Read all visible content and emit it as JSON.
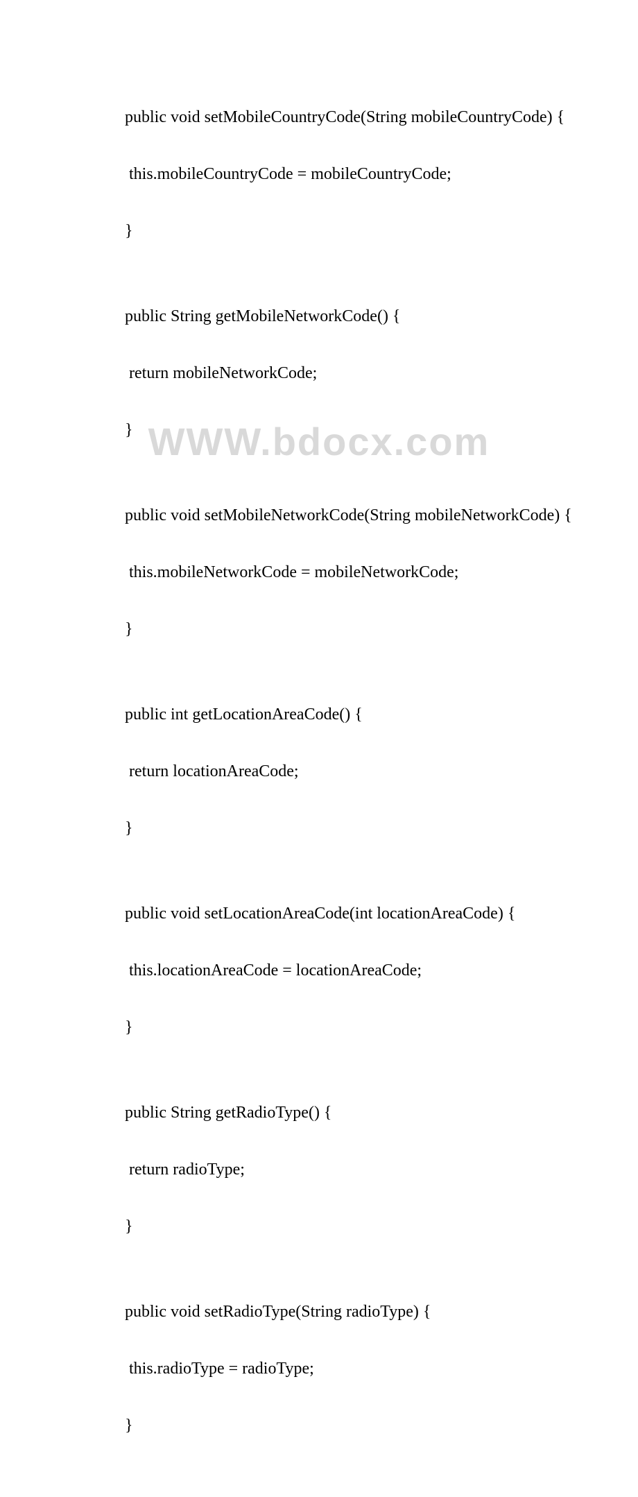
{
  "watermark": "WWW.bdocx.com",
  "lines": {
    "l0": "public void setMobileCountryCode(String mobileCountryCode) {",
    "l1": " this.mobileCountryCode = mobileCountryCode;",
    "l2": "}",
    "l3": "",
    "l4": "public String getMobileNetworkCode() {",
    "l5": " return mobileNetworkCode;",
    "l6": "}",
    "l7": "",
    "l8": "public void setMobileNetworkCode(String mobileNetworkCode) {",
    "l9": " this.mobileNetworkCode = mobileNetworkCode;",
    "l10": "}",
    "l11": "",
    "l12": "public int getLocationAreaCode() {",
    "l13": " return locationAreaCode;",
    "l14": "}",
    "l15": "",
    "l16": "public void setLocationAreaCode(int locationAreaCode) {",
    "l17": " this.locationAreaCode = locationAreaCode;",
    "l18": "}",
    "l19": "",
    "l20": "public String getRadioType() {",
    "l21": " return radioType;",
    "l22": "}",
    "l23": "",
    "l24": "public void setRadioType(String radioType) {",
    "l25": " this.radioType = radioType;",
    "l26": "}"
  }
}
